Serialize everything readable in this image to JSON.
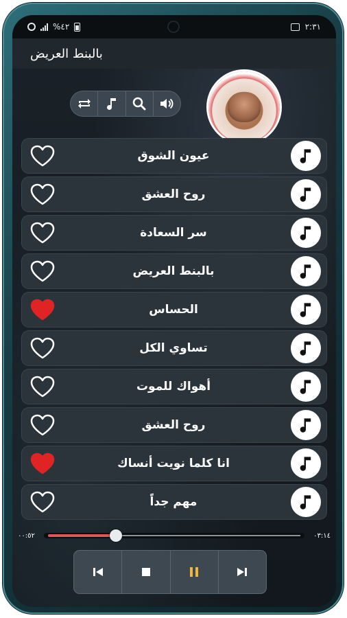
{
  "status_bar": {
    "time": "٢:٣١",
    "battery": "%٤٢"
  },
  "app": {
    "title": "بالبنط العريض"
  },
  "controls": [
    {
      "icon": "repeat-icon"
    },
    {
      "icon": "music-note-icon"
    },
    {
      "icon": "search-icon"
    },
    {
      "icon": "volume-icon"
    }
  ],
  "songs": [
    {
      "title": "عيون الشوق",
      "favorite": false
    },
    {
      "title": "روح العشق",
      "favorite": false
    },
    {
      "title": "سر السعادة",
      "favorite": false
    },
    {
      "title": "بالبنط العريض",
      "favorite": false
    },
    {
      "title": "الحساس",
      "favorite": true
    },
    {
      "title": "تساوي الكل",
      "favorite": false
    },
    {
      "title": "أهواك للموت",
      "favorite": false
    },
    {
      "title": "روح العشق",
      "favorite": false
    },
    {
      "title": "انا كلما نويت أنساك",
      "favorite": true
    },
    {
      "title": "مهم جداً",
      "favorite": false
    }
  ],
  "player": {
    "elapsed": "٠٠:٥٢",
    "duration": "٠٣:١٤",
    "progress": 0.27,
    "buttons": [
      {
        "icon": "previous-icon"
      },
      {
        "icon": "stop-icon"
      },
      {
        "icon": "pause-icon"
      },
      {
        "icon": "next-icon"
      }
    ]
  },
  "colors": {
    "accent_red": "#e02424",
    "pause_accent": "#f0b53a"
  }
}
